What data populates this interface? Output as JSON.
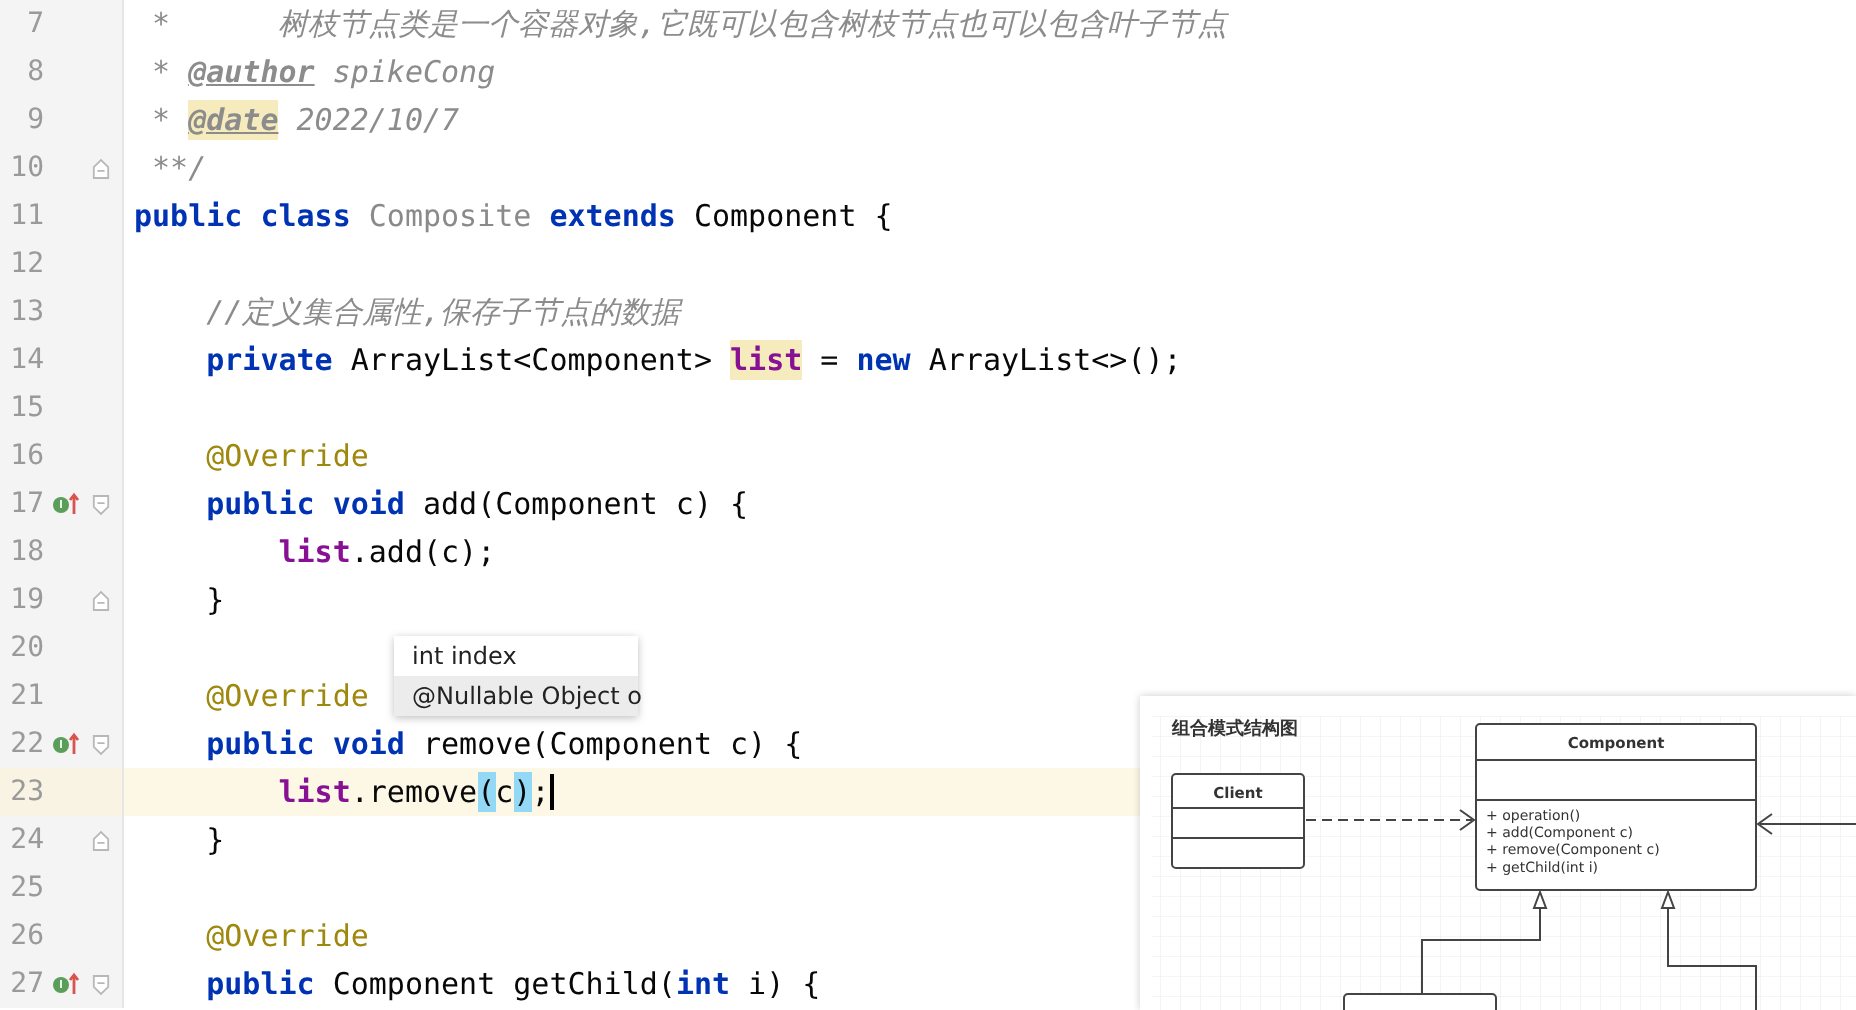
{
  "editor": {
    "lines": [
      {
        "number": "7",
        "override": false,
        "current": false,
        "fold_start": false,
        "fold_end": false,
        "tokens": [
          {
            "kind": "comment",
            "text": " *      树枝节点类是一个容器对象,它既可以包含树枝节点也可以包含叶子节点"
          }
        ]
      },
      {
        "number": "8",
        "override": false,
        "current": false,
        "fold_start": false,
        "fold_end": false,
        "tokens": [
          {
            "kind": "comment",
            "text": " * "
          },
          {
            "kind": "tag",
            "text": "@author"
          },
          {
            "kind": "comment",
            "text": " spikeCong"
          }
        ]
      },
      {
        "number": "9",
        "override": false,
        "current": false,
        "fold_start": false,
        "fold_end": false,
        "tokens": [
          {
            "kind": "comment",
            "text": " * "
          },
          {
            "kind": "taghl",
            "text": "@date"
          },
          {
            "kind": "comment",
            "text": " 2022/10/7"
          }
        ]
      },
      {
        "number": "10",
        "override": false,
        "current": false,
        "fold_start": false,
        "fold_end": true,
        "tokens": [
          {
            "kind": "comment",
            "text": " **/"
          }
        ]
      },
      {
        "number": "11",
        "override": false,
        "current": false,
        "fold_start": false,
        "fold_end": false,
        "tokens": [
          {
            "kind": "keyword",
            "text": "public class"
          },
          {
            "kind": "dim",
            "text": " Composite"
          },
          {
            "kind": "keyword",
            "text": " extends"
          },
          {
            "kind": "plain",
            "text": " Component {"
          }
        ]
      },
      {
        "number": "12",
        "override": false,
        "current": false,
        "fold_start": false,
        "fold_end": false
      },
      {
        "number": "13",
        "override": false,
        "current": false,
        "fold_start": false,
        "fold_end": false,
        "tokens": [
          {
            "kind": "comment",
            "text": "    //定义集合属性,保存子节点的数据"
          }
        ]
      },
      {
        "number": "14",
        "override": false,
        "current": false,
        "fold_start": false,
        "fold_end": false,
        "tokens": [
          {
            "kind": "keyword",
            "text": "    private"
          },
          {
            "kind": "plain",
            "text": " ArrayList<Component> "
          },
          {
            "kind": "fieldhl",
            "text": "list"
          },
          {
            "kind": "plain",
            "text": " = "
          },
          {
            "kind": "keyword",
            "text": "new"
          },
          {
            "kind": "plain",
            "text": " ArrayList<>();"
          }
        ]
      },
      {
        "number": "15",
        "override": false,
        "current": false,
        "fold_start": false,
        "fold_end": false
      },
      {
        "number": "16",
        "override": false,
        "current": false,
        "fold_start": false,
        "fold_end": false,
        "tokens": [
          {
            "kind": "annotation",
            "text": "    @Override"
          }
        ]
      },
      {
        "number": "17",
        "override": true,
        "current": false,
        "fold_start": true,
        "fold_end": false,
        "tokens": [
          {
            "kind": "keyword",
            "text": "    public void"
          },
          {
            "kind": "plain",
            "text": " add(Component c) {"
          }
        ]
      },
      {
        "number": "18",
        "override": false,
        "current": false,
        "fold_start": false,
        "fold_end": false,
        "tokens": [
          {
            "kind": "field",
            "text": "        list"
          },
          {
            "kind": "plain",
            "text": ".add(c);"
          }
        ]
      },
      {
        "number": "19",
        "override": false,
        "current": false,
        "fold_start": false,
        "fold_end": true,
        "tokens": [
          {
            "kind": "plain",
            "text": "    }"
          }
        ]
      },
      {
        "number": "20",
        "override": false,
        "current": false,
        "fold_start": false,
        "fold_end": false
      },
      {
        "number": "21",
        "override": false,
        "current": false,
        "fold_start": false,
        "fold_end": false,
        "tokens": [
          {
            "kind": "annotation",
            "text": "    @Override"
          }
        ]
      },
      {
        "number": "22",
        "override": true,
        "current": false,
        "fold_start": true,
        "fold_end": false,
        "tokens": [
          {
            "kind": "keyword",
            "text": "    public void"
          },
          {
            "kind": "plain",
            "text": " remove(Component c) {"
          }
        ]
      },
      {
        "number": "23",
        "override": false,
        "current": true,
        "fold_start": false,
        "fold_end": false,
        "tokens": [
          {
            "kind": "field",
            "text": "        list"
          },
          {
            "kind": "plain",
            "text": ".remove"
          },
          {
            "kind": "brace",
            "text": "("
          },
          {
            "kind": "plain",
            "text": "c"
          },
          {
            "kind": "brace",
            "text": ")"
          },
          {
            "kind": "plain",
            "text": ";"
          }
        ]
      },
      {
        "number": "24",
        "override": false,
        "current": false,
        "fold_start": false,
        "fold_end": true,
        "tokens": [
          {
            "kind": "plain",
            "text": "    }"
          }
        ]
      },
      {
        "number": "25",
        "override": false,
        "current": false,
        "fold_start": false,
        "fold_end": false
      },
      {
        "number": "26",
        "override": false,
        "current": false,
        "fold_start": false,
        "fold_end": false,
        "tokens": [
          {
            "kind": "annotation",
            "text": "    @Override"
          }
        ]
      },
      {
        "number": "27",
        "override": true,
        "current": false,
        "fold_start": true,
        "fold_end": false,
        "tokens": [
          {
            "kind": "keyword",
            "text": "    public"
          },
          {
            "kind": "plain",
            "text": " Component getChild("
          },
          {
            "kind": "keyword",
            "text": "int"
          },
          {
            "kind": "plain",
            "text": " i) {"
          }
        ]
      }
    ]
  },
  "parameter_popup": {
    "items": [
      {
        "text": "int index",
        "selected": false
      },
      {
        "text": "@Nullable Object o",
        "selected": true
      }
    ]
  },
  "diagram": {
    "title": "组合模式结构图",
    "client": {
      "name": "Client"
    },
    "component": {
      "name": "Component",
      "methods": [
        "+ operation()",
        "+ add(Component c)",
        "+ remove(Component c)",
        "+ getChild(int i)"
      ]
    }
  }
}
